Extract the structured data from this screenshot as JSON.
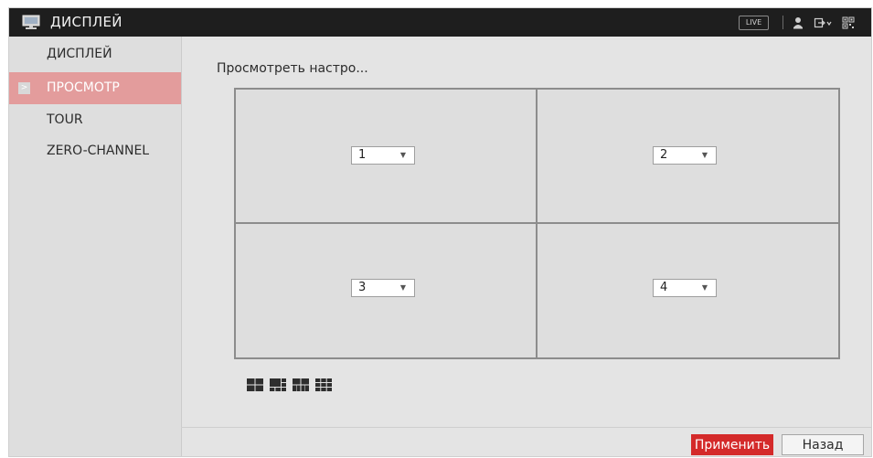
{
  "header": {
    "title": "ДИСПЛЕЙ",
    "live_label": "LIVE",
    "icons": [
      "monitor-icon",
      "user-icon",
      "logout-icon",
      "qr-code-icon"
    ]
  },
  "sidebar": {
    "items": [
      {
        "label": "ДИСПЛЕЙ",
        "active": false
      },
      {
        "label": "ПРОСМОТР",
        "active": true
      },
      {
        "label": "TOUR",
        "active": false
      },
      {
        "label": "ZERO-CHANNEL",
        "active": false
      }
    ],
    "active_chevron": ">"
  },
  "main": {
    "title": "Просмотреть настро...",
    "channels": [
      {
        "value": "1"
      },
      {
        "value": "2"
      },
      {
        "value": "3"
      },
      {
        "value": "4"
      }
    ],
    "layouts": [
      "layout-4-icon",
      "layout-6-icon",
      "layout-8-icon",
      "layout-9-icon"
    ]
  },
  "footer": {
    "apply_label": "Применить",
    "back_label": "Назад"
  },
  "colors": {
    "header_bg": "#1e1e1e",
    "active_item": "#e39c9c",
    "apply_button": "#d42a2a",
    "panel_bg": "#e4e4e4"
  }
}
